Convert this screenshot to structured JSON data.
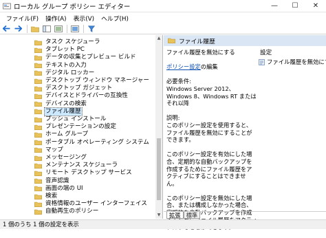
{
  "window": {
    "title": "ローカル グループ ポリシー エディター",
    "minimize": "—",
    "maximize": "☐",
    "close": "✕"
  },
  "menu": [
    "ファイル(F)",
    "操作(A)",
    "表示(V)",
    "ヘルプ(H)"
  ],
  "toolbar": {
    "icons": [
      "back-arrow-icon",
      "forward-arrow-icon",
      "folder-up-icon",
      "show-hide-tree-icon",
      "export-list-icon",
      "help-icon",
      "properties-icon",
      "filter-icon"
    ]
  },
  "tree": {
    "items": [
      {
        "label": "タスク スケジューラ",
        "selected": false
      },
      {
        "label": "タブレット PC",
        "selected": false
      },
      {
        "label": "データの収集とプレビュー ビルド",
        "selected": false
      },
      {
        "label": "テキストの入力",
        "selected": false
      },
      {
        "label": "デジタル ロッカー",
        "selected": false
      },
      {
        "label": "デスクトップ ウィンドウ マネージャー",
        "selected": false
      },
      {
        "label": "デスクトップ ガジェット",
        "selected": false
      },
      {
        "label": "デバイスとドライバーの互換性",
        "selected": false
      },
      {
        "label": "デバイスの検索",
        "selected": false
      },
      {
        "label": "ファイル履歴",
        "selected": true
      },
      {
        "label": "プッシュ インストール",
        "selected": false
      },
      {
        "label": "プレゼンテーションの設定",
        "selected": false
      },
      {
        "label": "ホーム グループ",
        "selected": false
      },
      {
        "label": "ポータブル オペレーティング システム",
        "selected": false
      },
      {
        "label": "マップ",
        "selected": false
      },
      {
        "label": "メッセージング",
        "selected": false
      },
      {
        "label": "メンテナンス スケジューラ",
        "selected": false
      },
      {
        "label": "リモート デスクトップ サービス",
        "selected": false
      },
      {
        "label": "音声認識",
        "selected": false
      },
      {
        "label": "画面の端の UI",
        "selected": false
      },
      {
        "label": "検索",
        "selected": false
      },
      {
        "label": "資格情報のユーザー インターフェイス",
        "selected": false
      },
      {
        "label": "自動再生のポリシー",
        "selected": false
      }
    ]
  },
  "right_pane": {
    "header": "ファイル履歴",
    "policy_title": "ファイル履歴を無効にする",
    "policy_link": "ポリシー設定",
    "policy_link_suffix": "の編集",
    "requirements_label": "必要条件:",
    "requirements_text": "Windows Server 2012、Windows 8、Windows RT またはそれ以降",
    "explanation_label": "説明:",
    "explanation_1": "このポリシー設定を使用すると、ファイル履歴を無効にすることができます。",
    "explanation_2": "このポリシー設定を有効にした場合、定期的な自動バックアップを作成するためにファイル履歴をアクティブにすることはできません。",
    "explanation_3": "このポリシー設定を無効にした場合、または構成しなかった場合、定期的な自動バックアップを作成するためにファイル履歴をアクティブにすることができます。",
    "settings_header": "設定",
    "settings_item": "ファイル履歴を無効にする"
  },
  "tabs": [
    "拡張",
    "標準"
  ],
  "status": "1 個のうち 1 個の設定を表示"
}
